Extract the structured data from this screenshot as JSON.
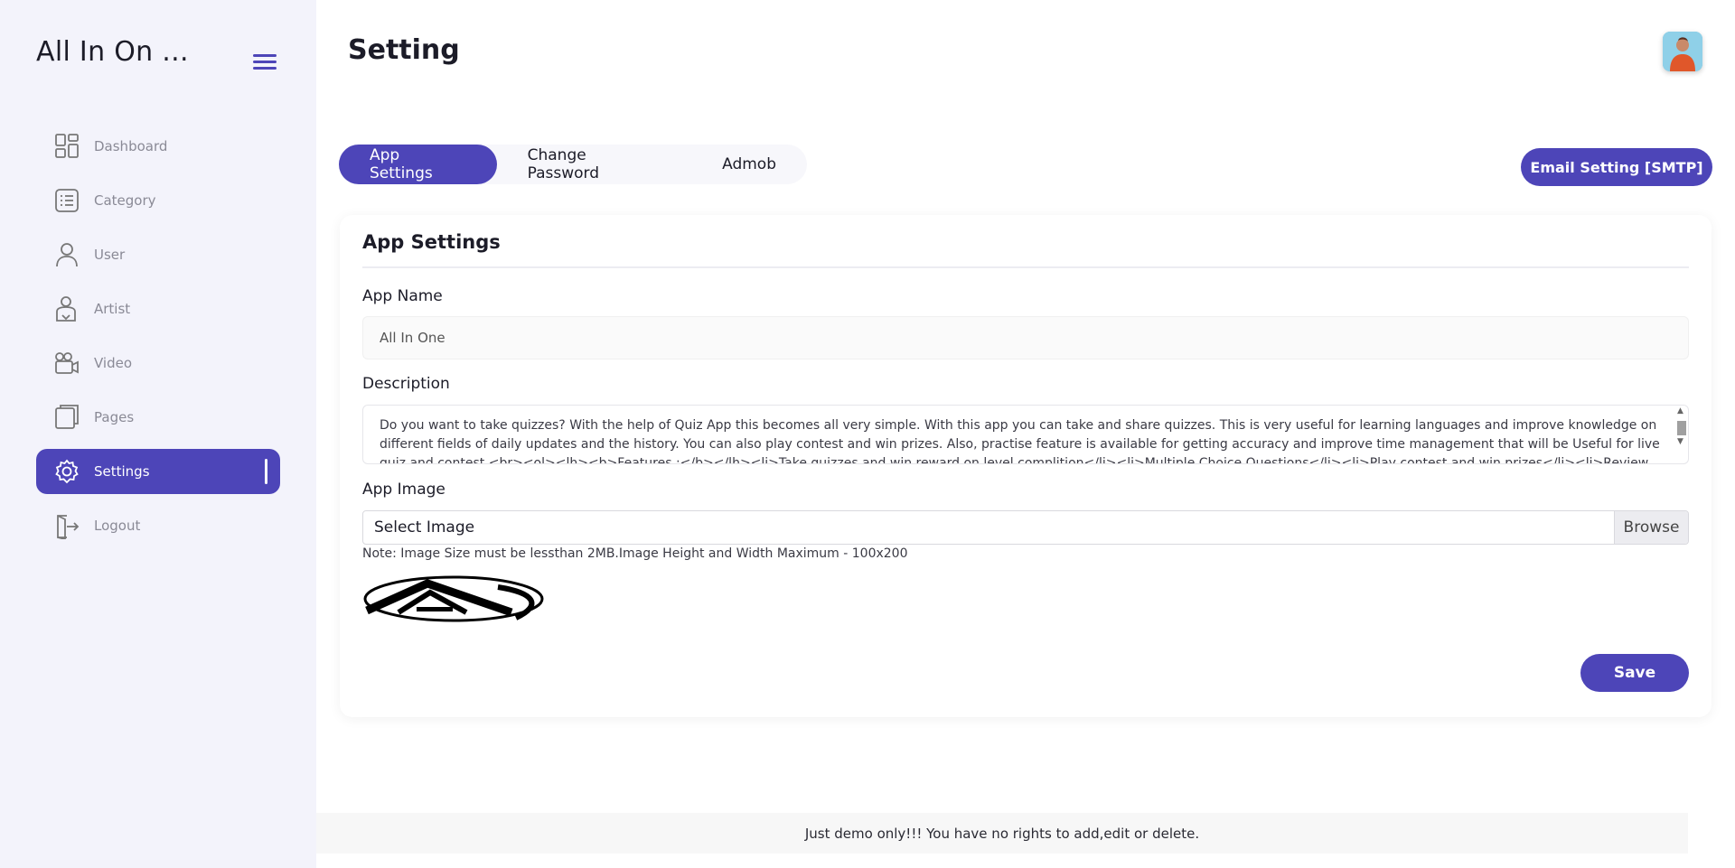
{
  "sidebar": {
    "brand": "All In On ...",
    "items": [
      {
        "label": "Dashboard",
        "icon": "dashboard-icon"
      },
      {
        "label": "Category",
        "icon": "list-icon"
      },
      {
        "label": "User",
        "icon": "user-icon"
      },
      {
        "label": "Artist",
        "icon": "artist-icon"
      },
      {
        "label": "Video",
        "icon": "video-camera-icon"
      },
      {
        "label": "Pages",
        "icon": "pages-icon"
      },
      {
        "label": "Settings",
        "icon": "gear-icon",
        "active": true
      },
      {
        "label": "Logout",
        "icon": "logout-icon"
      }
    ]
  },
  "header": {
    "title": "Setting"
  },
  "tabs": [
    {
      "label": "App Settings",
      "active": true
    },
    {
      "label": "Change Password"
    },
    {
      "label": "Admob"
    }
  ],
  "smtp_button": "Email Setting [SMTP]",
  "form": {
    "title": "App Settings",
    "app_name_label": "App Name",
    "app_name_value": "All In One",
    "description_label": "Description",
    "description_value": "Do you want to take quizzes? With the help of Quiz App this becomes all very simple. With this app you can take and share quizzes. This is very useful for learning languages and improve knowledge on different fields of daily updates and the history. You can also play contest and win prizes. Also, practise feature is available for getting accuracy and improve time management that will be Useful for live quiz and contest <br><ol><lh><b>Features :</b></lh><li>Take quizzes and win reward on level complition</li><li>Multiple Choice Questions</li><li>Play contest and win prizes</li><li>Review the contest",
    "image_label": "App Image",
    "select_image": "Select Image",
    "browse": "Browse",
    "note": "Note: Image Size must be lessthan 2MB.Image Height and Width Maximum - 100x200",
    "save": "Save"
  },
  "footer": "Just demo only!!! You have no rights to add,edit or delete.",
  "colors": {
    "accent": "#4d45b8",
    "sidebar_bg": "#f3f3fb"
  }
}
